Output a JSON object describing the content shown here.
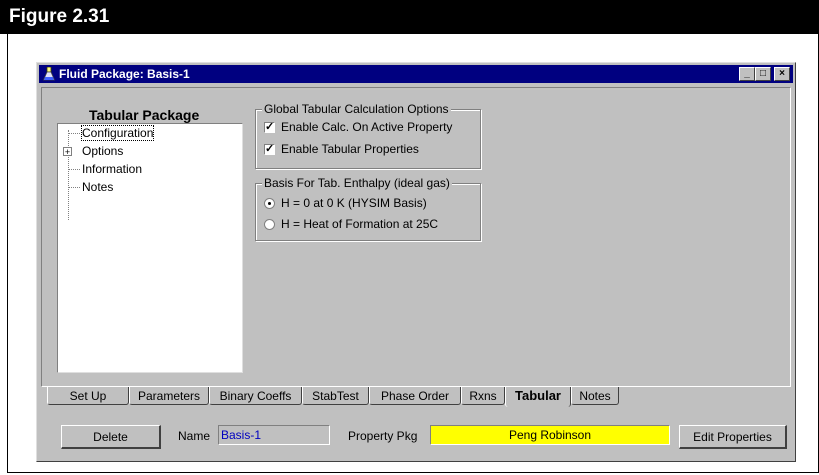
{
  "figure": {
    "title": "Figure 2.31"
  },
  "window": {
    "title": "Fluid Package: Basis-1",
    "controls": {
      "minimize": "_",
      "maximize": "□",
      "close": "×"
    }
  },
  "tree": {
    "header": "Tabular Package",
    "items": [
      {
        "label": "Configuration",
        "selected": true
      },
      {
        "label": "Options",
        "expandable": true
      },
      {
        "label": "Information"
      },
      {
        "label": "Notes"
      }
    ]
  },
  "global_options": {
    "legend": "Global Tabular Calculation Options",
    "enable_calc": {
      "label": "Enable Calc. On Active Property",
      "checked": true
    },
    "enable_tabular": {
      "label": "Enable Tabular Properties",
      "checked": true
    }
  },
  "enthalpy_basis": {
    "legend": "Basis For Tab. Enthalpy (ideal gas)",
    "options": [
      {
        "label": "H = 0 at 0 K (HYSIM Basis)",
        "selected": true
      },
      {
        "label": "H = Heat of Formation at 25C",
        "selected": false
      }
    ]
  },
  "tabs": [
    "Set Up",
    "Parameters",
    "Binary Coeffs",
    "StabTest",
    "Phase Order",
    "Rxns",
    "Tabular",
    "Notes"
  ],
  "active_tab": "Tabular",
  "bottom": {
    "delete_label": "Delete",
    "name_label": "Name",
    "name_value": "Basis-1",
    "property_pkg_label": "Property Pkg",
    "property_pkg_value": "Peng Robinson",
    "edit_properties_label": "Edit Properties"
  },
  "colors": {
    "titlebar": "#000080",
    "pkg_field": "#ffff00",
    "name_text": "#0000c0"
  }
}
